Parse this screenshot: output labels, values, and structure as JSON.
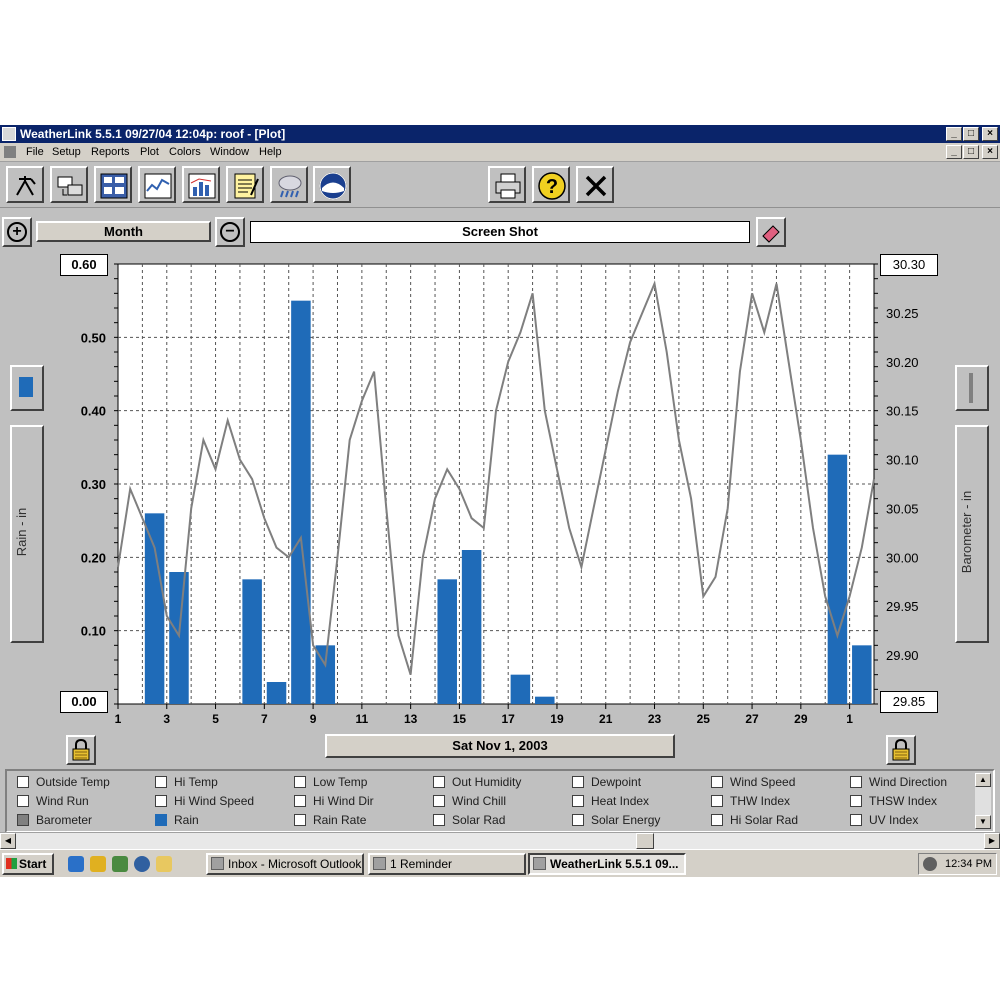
{
  "window": {
    "title": "WeatherLink 5.5.1  09/27/04  12:04p: roof - [Plot]",
    "controls": [
      "_",
      "□",
      "×"
    ]
  },
  "menu": {
    "items": [
      "File",
      "Setup",
      "Reports",
      "Plot",
      "Colors",
      "Window",
      "Help"
    ]
  },
  "toolbar": {
    "buttons": [
      "station-icon",
      "download-icon",
      "bulletin-icon",
      "strip-chart-icon",
      "plot-icon",
      "notes-icon",
      "weather-icon",
      "noaa-icon",
      "print-icon",
      "help-icon",
      "close-icon"
    ]
  },
  "nav": {
    "period": "Month",
    "title": "Screen Shot"
  },
  "chart_data": {
    "type": "bar+line",
    "x_ticks": [
      "1",
      "3",
      "5",
      "7",
      "9",
      "11",
      "13",
      "15",
      "17",
      "19",
      "21",
      "23",
      "25",
      "27",
      "29",
      "1"
    ],
    "left_axis": {
      "label": "Rain - in",
      "ticks": [
        "0.60",
        "0.50",
        "0.40",
        "0.30",
        "0.20",
        "0.10",
        "0.00"
      ],
      "range": [
        0,
        0.6
      ]
    },
    "right_axis": {
      "label": "Barometer - in",
      "ticks": [
        "30.30",
        "30.25",
        "30.20",
        "30.15",
        "30.10",
        "30.05",
        "30.00",
        "29.95",
        "29.90",
        "29.85"
      ],
      "range": [
        29.85,
        30.3
      ]
    },
    "grid": true,
    "rain": {
      "name": "Rain",
      "color": "#1f6bb8",
      "days": [
        2.5,
        3.5,
        6.5,
        7.5,
        8.5,
        9.5,
        14.5,
        15.5,
        17.5,
        18.5,
        30.5,
        31.5
      ],
      "values": [
        0.26,
        0.18,
        0.17,
        0.03,
        0.55,
        0.08,
        0.17,
        0.21,
        0.04,
        0.01,
        0.34,
        0.08
      ]
    },
    "barometer": {
      "name": "Barometer",
      "color": "#7f7f7f",
      "days": [
        1,
        1.5,
        2,
        2.5,
        3,
        3.5,
        4,
        4.5,
        5,
        5.5,
        6,
        6.5,
        7,
        7.5,
        8,
        8.5,
        9,
        9.5,
        10,
        10.5,
        11,
        11.5,
        12,
        12.5,
        13,
        13.5,
        14,
        14.5,
        15,
        15.5,
        16,
        16.5,
        17,
        17.5,
        18,
        18.5,
        19,
        19.5,
        20,
        20.5,
        21,
        21.5,
        22,
        22.5,
        23,
        23.5,
        24,
        24.5,
        25,
        25.5,
        26,
        26.5,
        27,
        27.5,
        28,
        28.5,
        29,
        29.5,
        30,
        30.5,
        31,
        31.5,
        32
      ],
      "values": [
        29.99,
        30.07,
        30.04,
        30.01,
        29.94,
        29.92,
        30.05,
        30.12,
        30.09,
        30.14,
        30.1,
        30.08,
        30.04,
        30.01,
        30.0,
        30.02,
        29.91,
        29.89,
        30.0,
        30.12,
        30.16,
        30.19,
        30.05,
        29.92,
        29.88,
        30.0,
        30.06,
        30.09,
        30.07,
        30.04,
        30.03,
        30.15,
        30.2,
        30.23,
        30.27,
        30.15,
        30.09,
        30.03,
        29.99,
        30.05,
        30.11,
        30.17,
        30.22,
        30.25,
        30.28,
        30.21,
        30.12,
        30.06,
        29.96,
        29.98,
        30.05,
        30.19,
        30.27,
        30.23,
        30.28,
        30.2,
        30.12,
        30.03,
        29.96,
        29.92,
        29.96,
        30.01,
        30.08
      ]
    }
  },
  "date_button": "Sat Nov 1, 2003",
  "legend": {
    "rows": [
      [
        {
          "label": "Outside Temp",
          "state": "off"
        },
        {
          "label": "Hi Temp",
          "state": "off"
        },
        {
          "label": "Low Temp",
          "state": "off"
        },
        {
          "label": "Out Humidity",
          "state": "off"
        },
        {
          "label": "Dewpoint",
          "state": "off"
        },
        {
          "label": "Wind Speed",
          "state": "off"
        },
        {
          "label": "Wind Direction",
          "state": "off"
        }
      ],
      [
        {
          "label": "Wind Run",
          "state": "off"
        },
        {
          "label": "Hi Wind Speed",
          "state": "off"
        },
        {
          "label": "Hi Wind Dir",
          "state": "off"
        },
        {
          "label": "Wind Chill",
          "state": "off"
        },
        {
          "label": "Heat Index",
          "state": "off"
        },
        {
          "label": "THW Index",
          "state": "off"
        },
        {
          "label": "THSW Index",
          "state": "off"
        }
      ],
      [
        {
          "label": "Barometer",
          "state": "gray"
        },
        {
          "label": "Rain",
          "state": "blue"
        },
        {
          "label": "Rain Rate",
          "state": "off"
        },
        {
          "label": "Solar Rad",
          "state": "off"
        },
        {
          "label": "Solar Energy",
          "state": "off"
        },
        {
          "label": "Hi Solar Rad",
          "state": "off"
        },
        {
          "label": "UV Index",
          "state": "off"
        }
      ]
    ]
  },
  "taskbar": {
    "start": "Start",
    "tasks": [
      "Inbox - Microsoft Outlook",
      "1 Reminder",
      "WeatherLink 5.5.1  09..."
    ],
    "clock": "12:34 PM"
  }
}
